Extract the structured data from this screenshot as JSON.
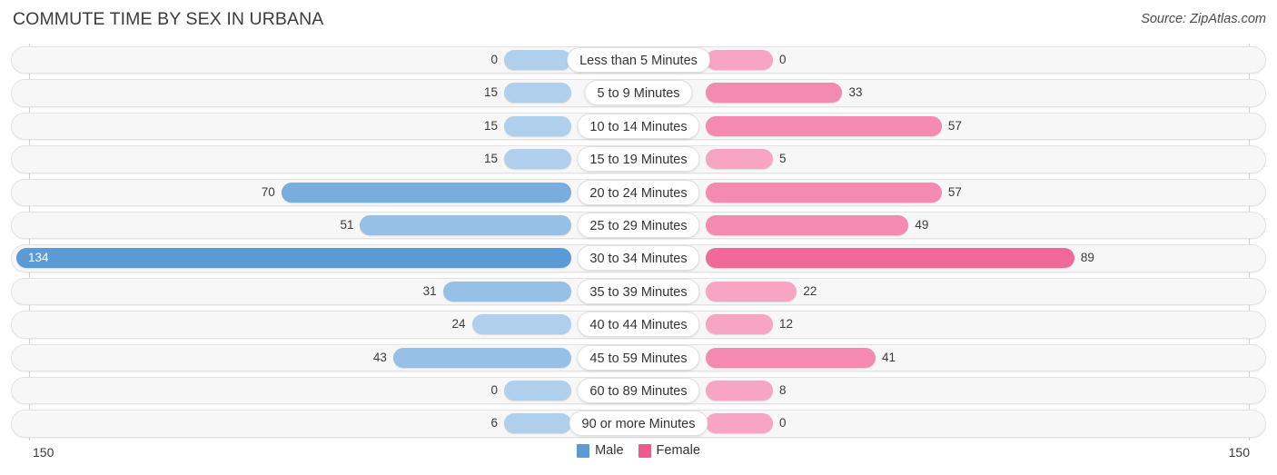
{
  "header": {
    "title": "COMMUTE TIME BY SEX IN URBANA",
    "source": "Source: ZipAtlas.com"
  },
  "axis": {
    "left_label": "150",
    "right_label": "150"
  },
  "legend": {
    "items": [
      {
        "label": "Male",
        "color": "#5B9BD5"
      },
      {
        "label": "Female",
        "color": "#EE5A8A"
      }
    ]
  },
  "chart_data": {
    "type": "bar",
    "title": "COMMUTE TIME BY SEX IN URBANA",
    "subtitle": "Source: ZipAtlas.com",
    "orientation": "horizontal-diverging",
    "xlabel": "",
    "ylabel": "",
    "xlim": [
      -150,
      150
    ],
    "axis_min_label": "150",
    "axis_max_label": "150",
    "grid": true,
    "legend_position": "bottom-center",
    "categories": [
      "Less than 5 Minutes",
      "5 to 9 Minutes",
      "10 to 14 Minutes",
      "15 to 19 Minutes",
      "20 to 24 Minutes",
      "25 to 29 Minutes",
      "30 to 34 Minutes",
      "35 to 39 Minutes",
      "40 to 44 Minutes",
      "45 to 59 Minutes",
      "60 to 89 Minutes",
      "90 or more Minutes"
    ],
    "series": [
      {
        "name": "Male",
        "color": "#5B9BD5",
        "values": [
          0,
          15,
          15,
          15,
          70,
          51,
          134,
          31,
          24,
          43,
          0,
          6
        ]
      },
      {
        "name": "Female",
        "color": "#EE5A8A",
        "values": [
          0,
          33,
          57,
          5,
          57,
          49,
          89,
          22,
          12,
          41,
          8,
          0
        ]
      }
    ],
    "max_value": 134
  },
  "rows": [
    {
      "label": "Less than 5 Minutes",
      "male": "0",
      "female": "0"
    },
    {
      "label": "5 to 9 Minutes",
      "male": "15",
      "female": "33"
    },
    {
      "label": "10 to 14 Minutes",
      "male": "15",
      "female": "57"
    },
    {
      "label": "15 to 19 Minutes",
      "male": "15",
      "female": "5"
    },
    {
      "label": "20 to 24 Minutes",
      "male": "70",
      "female": "57"
    },
    {
      "label": "25 to 29 Minutes",
      "male": "51",
      "female": "49"
    },
    {
      "label": "30 to 34 Minutes",
      "male": "134",
      "female": "89"
    },
    {
      "label": "35 to 39 Minutes",
      "male": "31",
      "female": "22"
    },
    {
      "label": "40 to 44 Minutes",
      "male": "24",
      "female": "12"
    },
    {
      "label": "45 to 59 Minutes",
      "male": "43",
      "female": "41"
    },
    {
      "label": "60 to 89 Minutes",
      "male": "0",
      "female": "8"
    },
    {
      "label": "90 or more Minutes",
      "male": "6",
      "female": "0"
    }
  ]
}
